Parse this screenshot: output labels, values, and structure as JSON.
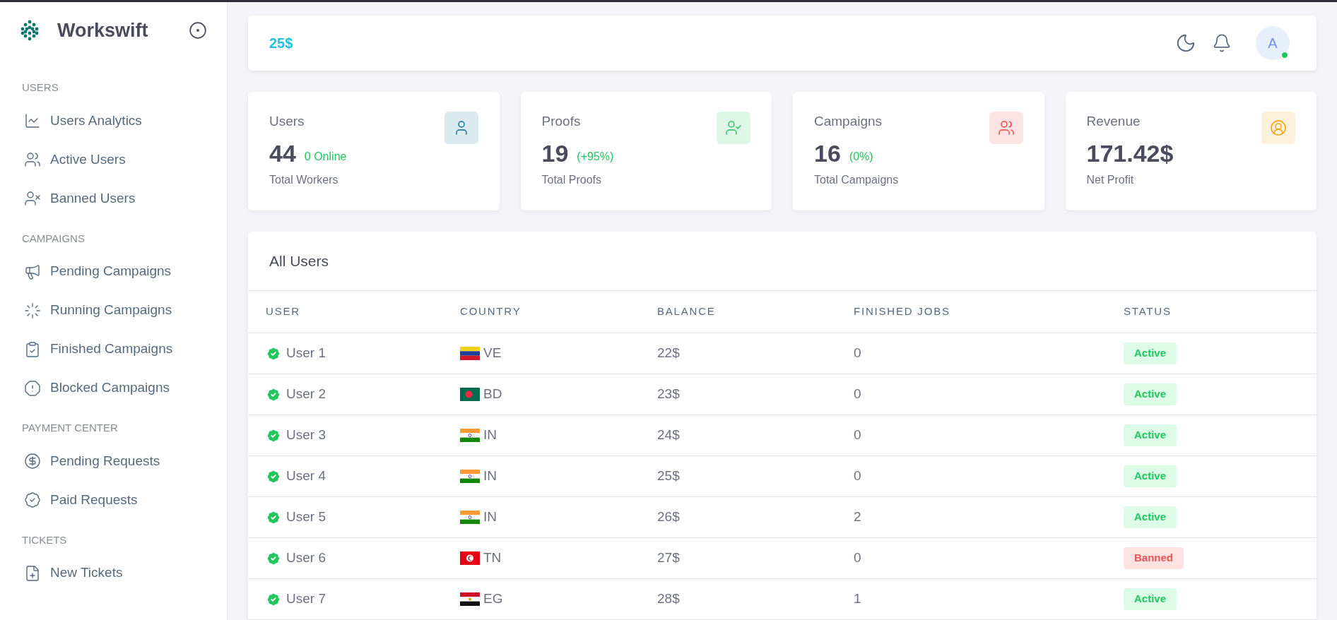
{
  "brand": {
    "name": "Workswift"
  },
  "sidebar": {
    "sections": [
      {
        "title": "USERS",
        "items": [
          {
            "label": "Users Analytics",
            "kind": "analytics"
          },
          {
            "label": "Active Users",
            "kind": "users"
          },
          {
            "label": "Banned Users",
            "kind": "user-off"
          }
        ]
      },
      {
        "title": "CAMPAIGNS",
        "items": [
          {
            "label": "Pending Campaigns",
            "kind": "megaphone"
          },
          {
            "label": "Running Campaigns",
            "kind": "loader"
          },
          {
            "label": "Finished Campaigns",
            "kind": "clipboard"
          },
          {
            "label": "Blocked Campaigns",
            "kind": "alert"
          }
        ]
      },
      {
        "title": "PAYMENT CENTER",
        "items": [
          {
            "label": "Pending Requests",
            "kind": "dollar"
          },
          {
            "label": "Paid Requests",
            "kind": "badge"
          }
        ]
      },
      {
        "title": "TICKETS",
        "items": [
          {
            "label": "New Tickets",
            "kind": "file-plus"
          }
        ]
      }
    ]
  },
  "topbar": {
    "balance": "25$",
    "avatar": {
      "initial": "A",
      "online": true
    }
  },
  "stats": [
    {
      "title": "Users",
      "value": "44",
      "note": "0 Online",
      "caption": "Total Workers",
      "kind": "user",
      "color": "#0e7490"
    },
    {
      "title": "Proofs",
      "value": "19",
      "note": "(+95%)",
      "caption": "Total Proofs",
      "kind": "user-check",
      "color": "#22c55e"
    },
    {
      "title": "Campaigns",
      "value": "16",
      "note": "(0%)",
      "caption": "Total Campaigns",
      "kind": "users",
      "color": "#ef4444"
    },
    {
      "title": "Revenue",
      "value": "171.42$",
      "caption": "Net Profit",
      "kind": "user-circle",
      "color": "#f59e0b"
    }
  ],
  "users_table": {
    "title": "All Users",
    "columns": [
      "USER",
      "COUNTRY",
      "BALANCE",
      "FINISHED JOBS",
      "STATUS"
    ],
    "rows": [
      {
        "user": "User 1",
        "country": {
          "code": "VE",
          "kind": "ve"
        },
        "balance": "22$",
        "finished_jobs": "0",
        "status": {
          "text": "Active",
          "kind": "active"
        }
      },
      {
        "user": "User 2",
        "country": {
          "code": "BD",
          "kind": "bd"
        },
        "balance": "23$",
        "finished_jobs": "0",
        "status": {
          "text": "Active",
          "kind": "active"
        }
      },
      {
        "user": "User 3",
        "country": {
          "code": "IN",
          "kind": "in"
        },
        "balance": "24$",
        "finished_jobs": "0",
        "status": {
          "text": "Active",
          "kind": "active"
        }
      },
      {
        "user": "User 4",
        "country": {
          "code": "IN",
          "kind": "in"
        },
        "balance": "25$",
        "finished_jobs": "0",
        "status": {
          "text": "Active",
          "kind": "active"
        }
      },
      {
        "user": "User 5",
        "country": {
          "code": "IN",
          "kind": "in"
        },
        "balance": "26$",
        "finished_jobs": "2",
        "status": {
          "text": "Active",
          "kind": "active"
        }
      },
      {
        "user": "User 6",
        "country": {
          "code": "TN",
          "kind": "tn"
        },
        "balance": "27$",
        "finished_jobs": "0",
        "status": {
          "text": "Banned",
          "kind": "banned"
        }
      },
      {
        "user": "User 7",
        "country": {
          "code": "EG",
          "kind": "eg"
        },
        "balance": "28$",
        "finished_jobs": "1",
        "status": {
          "text": "Active",
          "kind": "active"
        }
      }
    ]
  }
}
